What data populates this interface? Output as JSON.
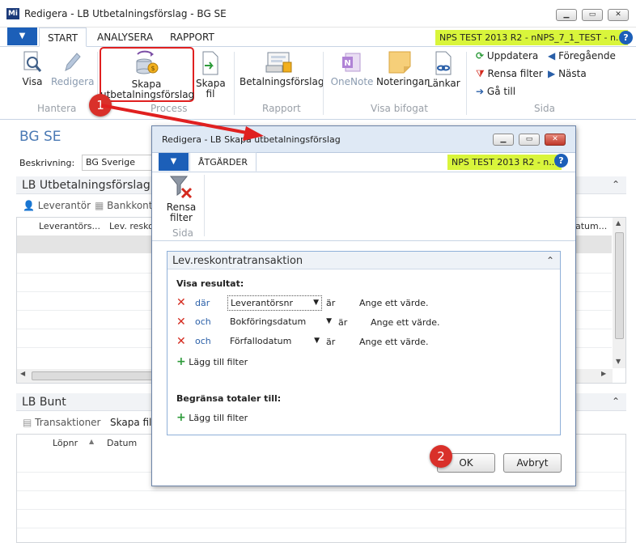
{
  "window": {
    "title": "Redigera - LB Utbetalningsförslag - BG SE",
    "logo": "Mi"
  },
  "ribbon": {
    "tabs": [
      "START",
      "ANALYSERA",
      "RAPPORT"
    ],
    "company": "NPS TEST 2013 R2 - nNPS_7_1_TEST - n...",
    "buttons": {
      "visa": "Visa",
      "redigera": "Redigera",
      "skapa": "Skapa utbetalningsförslag",
      "skapa_fil": "Skapa fil",
      "betalningsforslag": "Betalningsförslag",
      "onenote": "OneNote",
      "noteringar": "Noteringar",
      "lankar": "Länkar",
      "uppdatera": "Uppdatera",
      "rensa_filter": "Rensa filter",
      "ga_till": "Gå till",
      "foregaende": "Föregående",
      "nasta": "Nästa"
    },
    "groups": {
      "hantera": "Hantera",
      "process": "Process",
      "rapport": "Rapport",
      "visa_bifogat": "Visa bifogat",
      "sida": "Sida"
    }
  },
  "page": {
    "title": "BG SE",
    "beskrivning_label": "Beskrivning:",
    "beskrivning_value": "BG Sverige",
    "section1": {
      "title": "LB Utbetalningsförslag",
      "actions": [
        "Leverantör",
        "Bankkont"
      ],
      "columns": [
        "Leverantörs...",
        "Lev. resko",
        "atum..."
      ]
    },
    "section2": {
      "title": "LB Bunt",
      "actions": [
        "Transaktioner",
        "Skapa fil"
      ],
      "columns": [
        "Löpnr",
        "Datum"
      ]
    }
  },
  "dialog": {
    "title": "Redigera - LB Skapa utbetalningsförslag",
    "tab": "ÅTGÄRDER",
    "company": "NPS TEST 2013 R2 - n...",
    "rensa_filter": "Rensa filter",
    "group_sida": "Sida",
    "filter_section": "Lev.reskontratransaktion",
    "visa_resultat": "Visa resultat:",
    "filters": [
      {
        "conj": "där",
        "field": "Leverantörsnr",
        "op": "är",
        "value": "Ange ett värde."
      },
      {
        "conj": "och",
        "field": "Bokföringsdatum",
        "op": "är",
        "value": "Ange ett värde."
      },
      {
        "conj": "och",
        "field": "Förfallodatum",
        "op": "är",
        "value": "Ange ett värde."
      }
    ],
    "add_filter": "Lägg till filter",
    "begransa": "Begränsa totaler till:",
    "add_filter2": "Lägg till filter",
    "ok": "OK",
    "cancel": "Avbryt"
  },
  "annotations": {
    "step1": "1",
    "step2": "2"
  },
  "colors": {
    "accent": "#1c5fb8",
    "company_bg": "#d9f53b",
    "annotation_red": "#d9302a",
    "highlight_box": "#e02020"
  },
  "icons": [
    "magnifier-icon",
    "pencil-icon",
    "create-proposal-icon",
    "create-file-icon",
    "report-icon",
    "onenote-icon",
    "notes-icon",
    "links-icon",
    "refresh-icon",
    "clear-filter-icon",
    "goto-icon",
    "previous-icon",
    "next-icon",
    "funnel-clear-icon"
  ]
}
